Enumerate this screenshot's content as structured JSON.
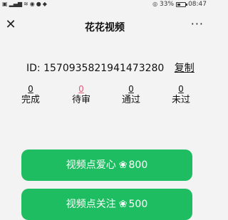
{
  "statusbar": {
    "left_icons": [
      "sim-icon",
      "signal-icon",
      "wifi-icon",
      "location-icon",
      "wechat-icon",
      "app-icon"
    ],
    "battery_percent": "33%",
    "time": "08:47"
  },
  "nav": {
    "title": "花花视频",
    "close_glyph": "✕",
    "more_glyph": "···"
  },
  "account": {
    "id_label": "ID:",
    "id_value": "1570935821941473280",
    "copy_label": "复制"
  },
  "stats": [
    {
      "count": "0",
      "label": "完成"
    },
    {
      "count": "0",
      "label": "待审"
    },
    {
      "count": "0",
      "label": "通过"
    },
    {
      "count": "0",
      "label": "未过"
    }
  ],
  "actions": [
    {
      "label": "视频点爱心",
      "icon": "❀",
      "points": "800"
    },
    {
      "label": "视频点关注",
      "icon": "❀",
      "points": "500"
    }
  ],
  "colors": {
    "accent_green": "#1fbd61",
    "pending_pink": "#e05a7a"
  }
}
